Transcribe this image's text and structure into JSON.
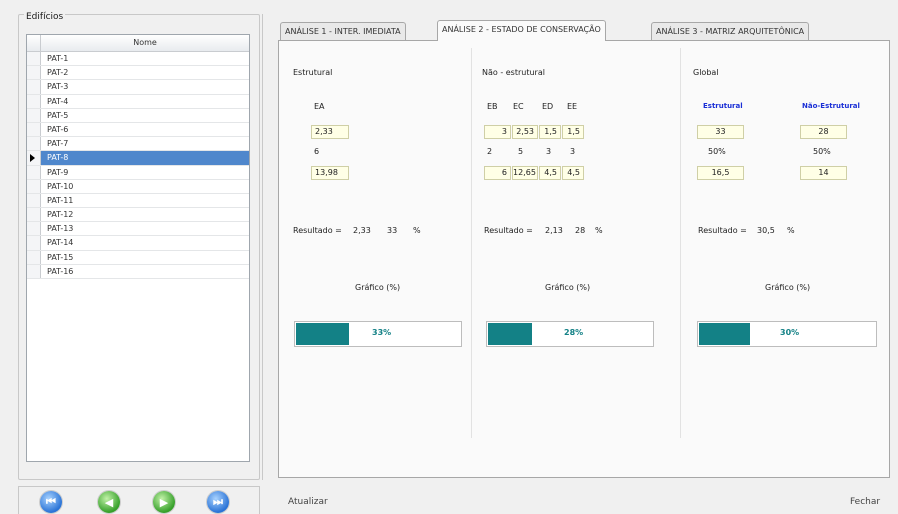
{
  "left_panel": {
    "group_title": "Edifícios",
    "grid": {
      "column_header": "Nome",
      "selected_index": 7,
      "rows": [
        "PAT-1",
        "PAT-2",
        "PAT-3",
        "PAT-4",
        "PAT-5",
        "PAT-6",
        "PAT-7",
        "PAT-8",
        "PAT-9",
        "PAT-10",
        "PAT-11",
        "PAT-12",
        "PAT-13",
        "PAT-14",
        "PAT-15",
        "PAT-16"
      ]
    },
    "nav_buttons": [
      {
        "icon": "first-record-icon"
      },
      {
        "icon": "previous-record-icon"
      },
      {
        "icon": "next-record-icon"
      },
      {
        "icon": "last-record-icon"
      }
    ]
  },
  "tabs": [
    {
      "label": "ANÁLISE 1 - INTER. IMEDIATA",
      "active": false
    },
    {
      "label": "ANÁLISE 2 - ESTADO DE CONSERVAÇÃO",
      "active": true
    },
    {
      "label": "ANÁLISE 3 - MATRIZ ARQUITETÔNICA",
      "active": false
    }
  ],
  "estrutural": {
    "title": "Estrutural",
    "col_label": "EA",
    "rows": [
      "2,33",
      "6",
      "13,98"
    ],
    "result_label": "Resultado =",
    "result_value": "2,33",
    "result_percent": "33",
    "percent_sign": "%",
    "chart_title": "Gráfico (%)",
    "progress": {
      "value": 33,
      "label": "33%"
    }
  },
  "nao_estrutural": {
    "title": "Não - estrutural",
    "headers": [
      "EB",
      "EC",
      "ED",
      "EE"
    ],
    "rows": [
      [
        "3",
        "2,53",
        "1,5",
        "1,5"
      ],
      [
        "2",
        "5",
        "3",
        "3"
      ],
      [
        "6",
        "12,65",
        "4,5",
        "4,5"
      ]
    ],
    "result_label": "Resultado =",
    "result_value": "2,13",
    "result_percent": "28",
    "percent_sign": "%",
    "chart_title": "Gráfico (%)",
    "progress": {
      "value": 28,
      "label": "28%"
    }
  },
  "global": {
    "title": "Global",
    "headers": [
      "Estrutural",
      "Não-Estrutural"
    ],
    "rows": [
      [
        "33",
        "28"
      ],
      [
        "50%",
        "50%"
      ],
      [
        "16,5",
        "14"
      ]
    ],
    "result_label": "Resultado =",
    "result_value": "30,5",
    "percent_sign": "%",
    "chart_title": "Gráfico (%)",
    "progress": {
      "value": 30,
      "label": "30%"
    }
  },
  "footer": {
    "update_label": "Atualizar",
    "close_label": "Fechar"
  },
  "colors": {
    "progress_fill": "#138186",
    "selection": "#4f87cc",
    "header_blue": "#1a2fd6"
  }
}
